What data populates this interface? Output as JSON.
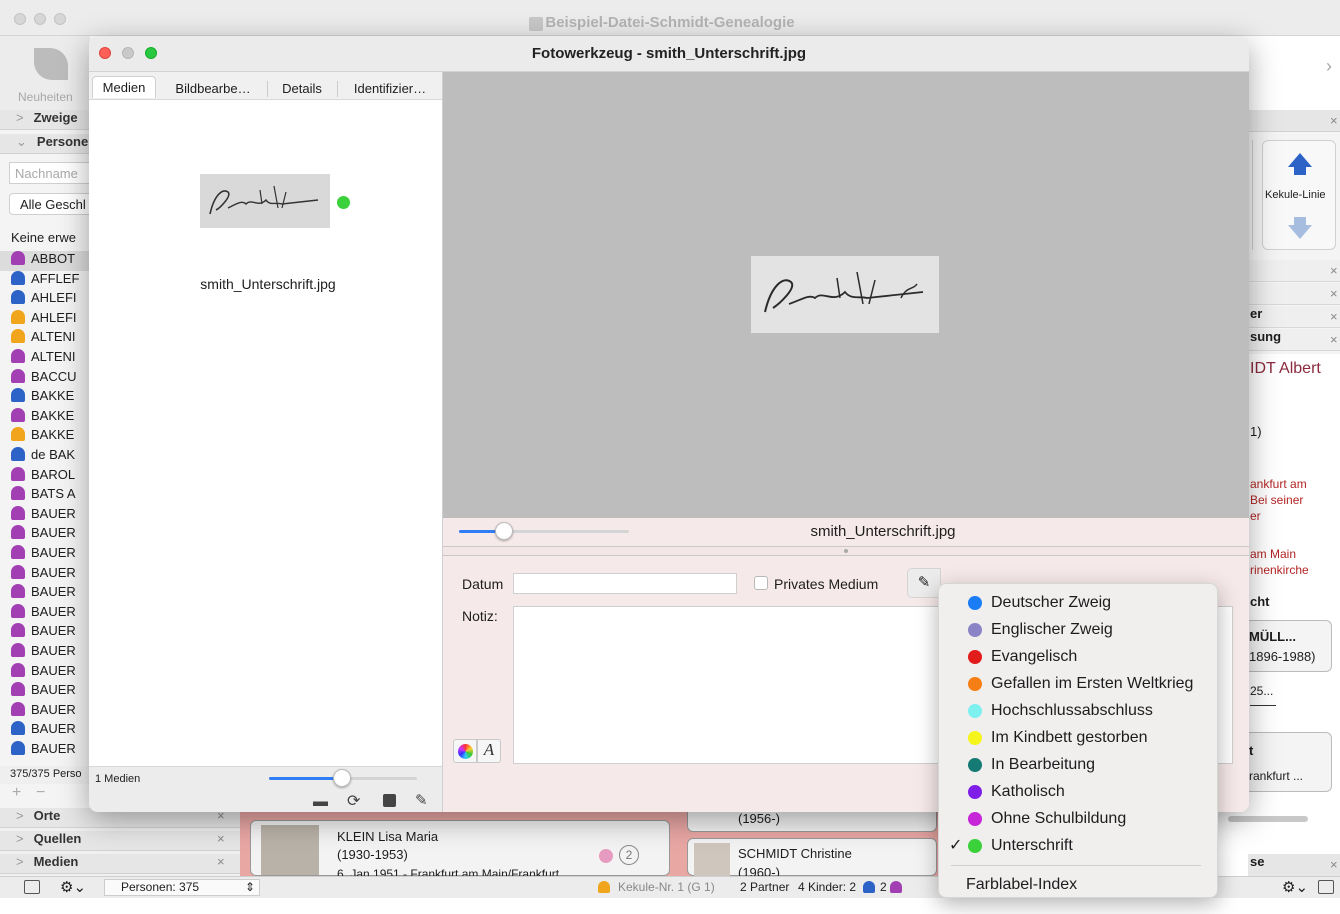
{
  "main_window": {
    "title": "Beispiel-Datei-Schmidt-Genealogie",
    "toolbar_label": "Neuheiten",
    "sections": {
      "zweige": "Zweige",
      "personen": "Personen",
      "orte": "Orte",
      "quellen": "Quellen",
      "medien": "Medien"
    },
    "search_placeholder": "Nachname",
    "gender_filter": "Alle Geschl",
    "filter_text": "Keine erwe",
    "persons": [
      {
        "name": "ABBOT",
        "color": "#a23fb3"
      },
      {
        "name": "AFFLEF",
        "color": "#2d62c7"
      },
      {
        "name": "AHLEFI",
        "color": "#2d62c7"
      },
      {
        "name": "AHLEFI",
        "color": "#f0a51c"
      },
      {
        "name": "ALTENI",
        "color": "#f0a51c"
      },
      {
        "name": "ALTENI",
        "color": "#a23fb3"
      },
      {
        "name": "BACCU",
        "color": "#a23fb3"
      },
      {
        "name": "BAKKE",
        "color": "#2d62c7"
      },
      {
        "name": "BAKKE",
        "color": "#a23fb3"
      },
      {
        "name": "BAKKE",
        "color": "#f0a51c"
      },
      {
        "name": "de BAK",
        "color": "#2d62c7"
      },
      {
        "name": "BAROL",
        "color": "#a23fb3"
      },
      {
        "name": "BATS A",
        "color": "#a23fb3"
      },
      {
        "name": "BAUER",
        "color": "#a23fb3"
      },
      {
        "name": "BAUER",
        "color": "#a23fb3"
      },
      {
        "name": "BAUER",
        "color": "#a23fb3"
      },
      {
        "name": "BAUER",
        "color": "#a23fb3"
      },
      {
        "name": "BAUER",
        "color": "#a23fb3"
      },
      {
        "name": "BAUER",
        "color": "#a23fb3"
      },
      {
        "name": "BAUER",
        "color": "#a23fb3"
      },
      {
        "name": "BAUER",
        "color": "#a23fb3"
      },
      {
        "name": "BAUER",
        "color": "#a23fb3"
      },
      {
        "name": "BAUER",
        "color": "#a23fb3"
      },
      {
        "name": "BAUER",
        "color": "#a23fb3"
      },
      {
        "name": "BAUER",
        "color": "#2d62c7"
      },
      {
        "name": "BAUER",
        "color": "#2d62c7"
      }
    ],
    "person_count": "375/375 Perso",
    "kekule_label": "Kekule-Linie",
    "right_rows": [
      "er",
      "sung"
    ],
    "right_name": "IDT Albert",
    "right_texts": [
      "1)",
      "ankfurt am",
      "Bei seiner",
      "er",
      "am Main",
      "rinenkirche",
      "cht",
      "MÜLL...",
      "1896-1988)",
      "25...",
      "t",
      "rankfurt ...",
      "se"
    ],
    "family_cards": [
      {
        "name": "KLEIN Lisa Maria",
        "dates": "(1930-1953)",
        "extra": "2"
      },
      {
        "name": "SCHMIDT Christine",
        "dates": "(1960-)"
      }
    ],
    "partial_date": "(1956-)",
    "partial_event": "6. Jan 1951 - Frankfurt am Main/Frankfurt",
    "status": {
      "persons": "Personen: 375",
      "kekule": "Kekule-Nr. 1 (G 1)",
      "partner": "2 Partner",
      "children": "4 Kinder: 2",
      "children2": "2"
    }
  },
  "photo_tool": {
    "title": "Fotowerkzeug - smith_Unterschrift.jpg",
    "tabs": [
      "Medien",
      "Bildbearbe…",
      "Details",
      "Identifizier…"
    ],
    "active_tab": "Medien",
    "thumbnail_name": "smith_Unterschrift.jpg",
    "thumbnail_label_color": "#3ad13a",
    "signature_text": "Smith",
    "media_count": "1 Medien",
    "caption": "smith_Unterschrift.jpg",
    "date_label": "Datum",
    "date_value": "",
    "private_label": "Privates Medium",
    "private_checked": false,
    "note_label": "Notiz:",
    "note_value": ""
  },
  "color_menu": {
    "items": [
      {
        "label": "Deutscher Zweig",
        "color": "#1a7df5",
        "checked": false
      },
      {
        "label": "Englischer Zweig",
        "color": "#8a84c6",
        "checked": false
      },
      {
        "label": "Evangelisch",
        "color": "#e21b1b",
        "checked": false
      },
      {
        "label": "Gefallen im Ersten Weltkrieg",
        "color": "#f57f14",
        "checked": false
      },
      {
        "label": "Hochschlussabschluss",
        "color": "#7ff0f0",
        "checked": false
      },
      {
        "label": "Im Kindbett gestorben",
        "color": "#f5f51c",
        "checked": false
      },
      {
        "label": "In Bearbeitung",
        "color": "#157a74",
        "checked": false
      },
      {
        "label": "Katholisch",
        "color": "#7f1ee8",
        "checked": false
      },
      {
        "label": "Ohne Schulbildung",
        "color": "#c625d8",
        "checked": false
      },
      {
        "label": "Unterschrift",
        "color": "#3ad13a",
        "checked": true
      }
    ],
    "checkmark": "✓",
    "footer": "Farblabel-Index"
  }
}
